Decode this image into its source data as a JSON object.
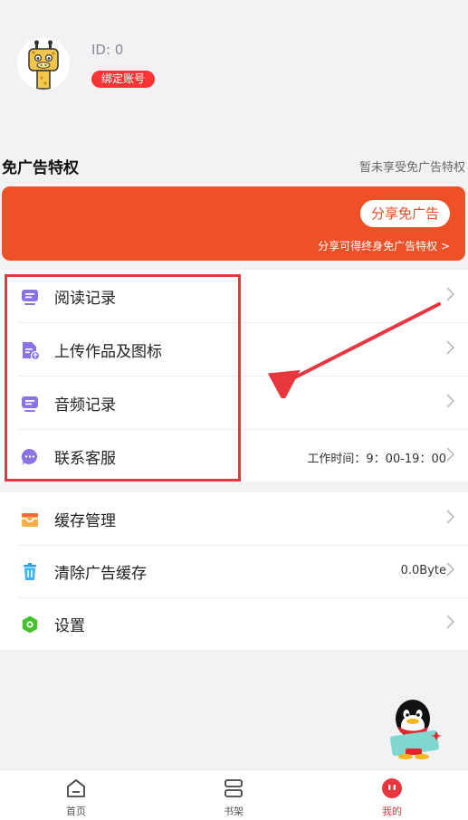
{
  "profile": {
    "id_text": "ID: 0",
    "bind_label": "绑定账号"
  },
  "ad_free": {
    "title": "免广告特权",
    "status": "暂未享受免广告特权",
    "share_button": "分享免广告",
    "share_note": "分享可得终身免广告特权 >"
  },
  "menu_primary": [
    {
      "label": "阅读记录",
      "icon": "book-icon"
    },
    {
      "label": "上传作品及图标",
      "icon": "upload-document-icon"
    },
    {
      "label": "音频记录",
      "icon": "audio-icon"
    },
    {
      "label": "联系客服",
      "icon": "chat-icon",
      "value": "工作时间：9：00-19：00"
    }
  ],
  "menu_secondary": [
    {
      "label": "缓存管理",
      "icon": "inbox-icon"
    },
    {
      "label": "清除广告缓存",
      "icon": "trash-icon",
      "value": "0.0Byte"
    },
    {
      "label": "设置",
      "icon": "gear-icon"
    }
  ],
  "tabbar": [
    {
      "label": "首页",
      "icon": "home-icon"
    },
    {
      "label": "书架",
      "icon": "bookshelf-icon"
    },
    {
      "label": "我的",
      "icon": "profile-icon",
      "active": true
    }
  ],
  "colors": {
    "accent": "#e8363f",
    "promo": "#ee5127",
    "menu_icon": "#8b73e6"
  }
}
